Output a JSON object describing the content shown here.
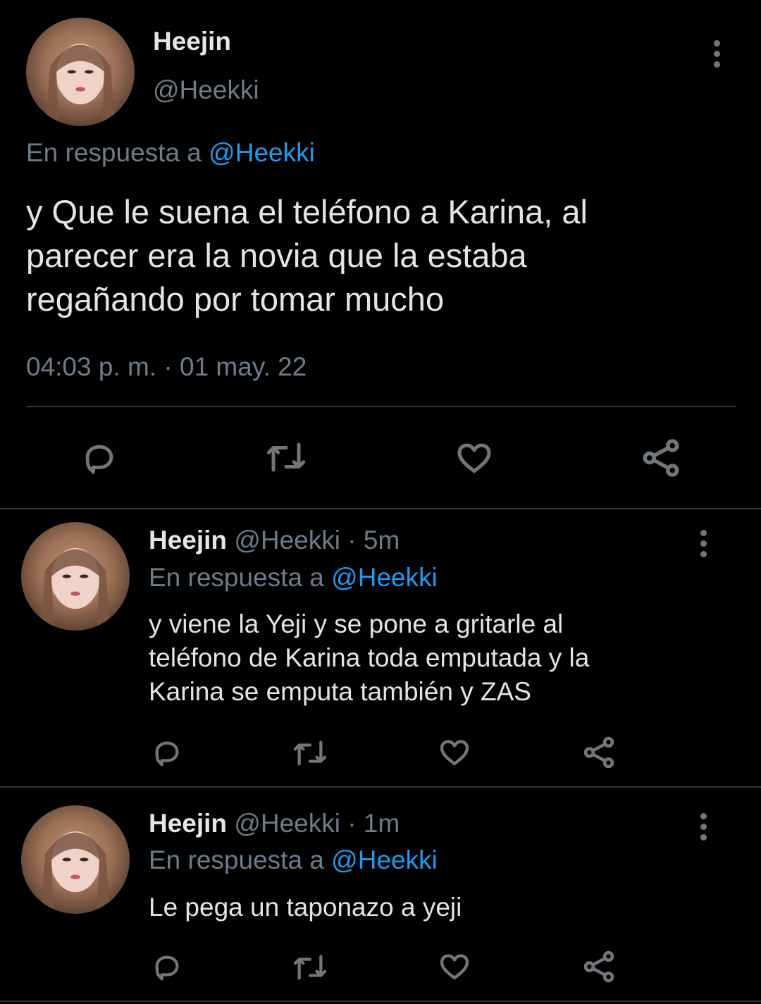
{
  "main_tweet": {
    "author_name": "Heejin",
    "author_handle": "@Heekki",
    "reply_prefix": "En respuesta a",
    "reply_to": "@Heekki",
    "text_lines": [
      "y Que le suena el teléfono a Karina, al",
      "parecer era la novia que la estaba",
      "regañando por tomar mucho"
    ],
    "timestamp": "04:03 p. m. · 01 may. 22"
  },
  "replies": [
    {
      "author_name": "Heejin",
      "handle_time": "@Heekki · 5m",
      "reply_prefix": "En respuesta a",
      "reply_to": "@Heekki",
      "text_lines": [
        "y viene la Yeji y se pone a gritarle al",
        "teléfono de Karina toda emputada y la",
        "Karina se emputa también y ZAS"
      ]
    },
    {
      "author_name": "Heejin",
      "handle_time": "@Heekki · 1m",
      "reply_prefix": "En respuesta a",
      "reply_to": "@Heekki",
      "text_lines": [
        "Le pega un taponazo a yeji"
      ]
    }
  ],
  "icons": {
    "reply": "reply-icon",
    "retweet": "retweet-icon",
    "like": "heart-icon",
    "share": "share-icon",
    "more": "more-options-icon"
  },
  "colors": {
    "background": "#000000",
    "link": "#1d9bf0",
    "muted": "#6e7b88",
    "text": "#d9d9d9"
  }
}
